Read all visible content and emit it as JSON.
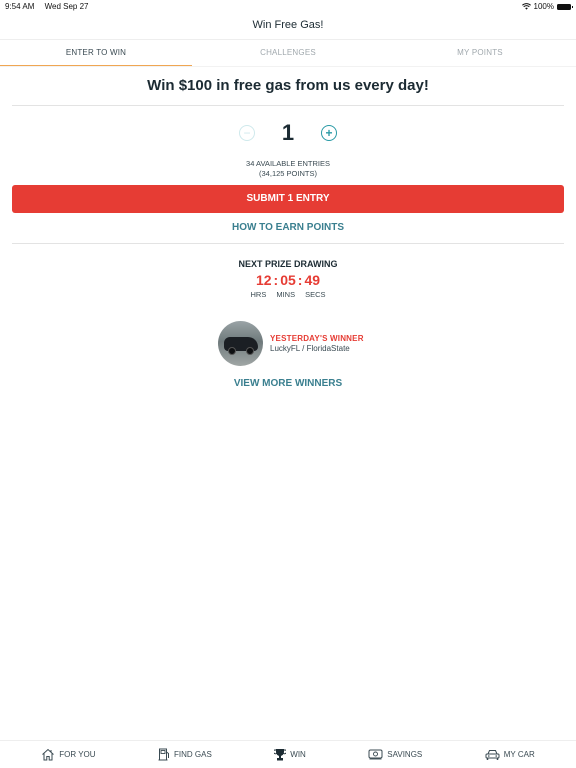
{
  "status_bar": {
    "time": "9:54 AM",
    "date": "Wed Sep 27",
    "battery": "100%"
  },
  "nav": {
    "title": "Win Free Gas!"
  },
  "tabs": [
    {
      "label": "ENTER TO WIN",
      "active": true
    },
    {
      "label": "CHALLENGES",
      "active": false
    },
    {
      "label": "MY POINTS",
      "active": false
    }
  ],
  "main": {
    "headline": "Win $100 in free gas from us every day!",
    "stepper": {
      "minus": "−",
      "value": "1",
      "plus": "+"
    },
    "available_entries": "34 AVAILABLE ENTRIES",
    "points": "(34,125 POINTS)",
    "submit_label": "SUBMIT 1 ENTRY",
    "earn_link": "HOW TO EARN POINTS",
    "next_drawing": {
      "title": "NEXT PRIZE DRAWING",
      "hours": "12",
      "minutes": "05",
      "seconds": "49",
      "separator": ":",
      "labels": {
        "hours": "HRS",
        "minutes": "MINS",
        "seconds": "SECS"
      }
    },
    "winner": {
      "label": "YESTERDAY'S WINNER",
      "name": "LuckyFL / FloridaState"
    },
    "more_winners": "VIEW MORE WINNERS"
  },
  "bottom_nav": [
    {
      "label": "FOR YOU",
      "icon": "home-icon"
    },
    {
      "label": "FIND GAS",
      "icon": "gas-pump-icon"
    },
    {
      "label": "WIN",
      "icon": "trophy-icon"
    },
    {
      "label": "SAVINGS",
      "icon": "money-icon"
    },
    {
      "label": "MY CAR",
      "icon": "car-icon"
    }
  ],
  "colors": {
    "accent_red": "#e63c34",
    "teal": "#3a7f8f",
    "tab_underline": "#f0a652"
  }
}
